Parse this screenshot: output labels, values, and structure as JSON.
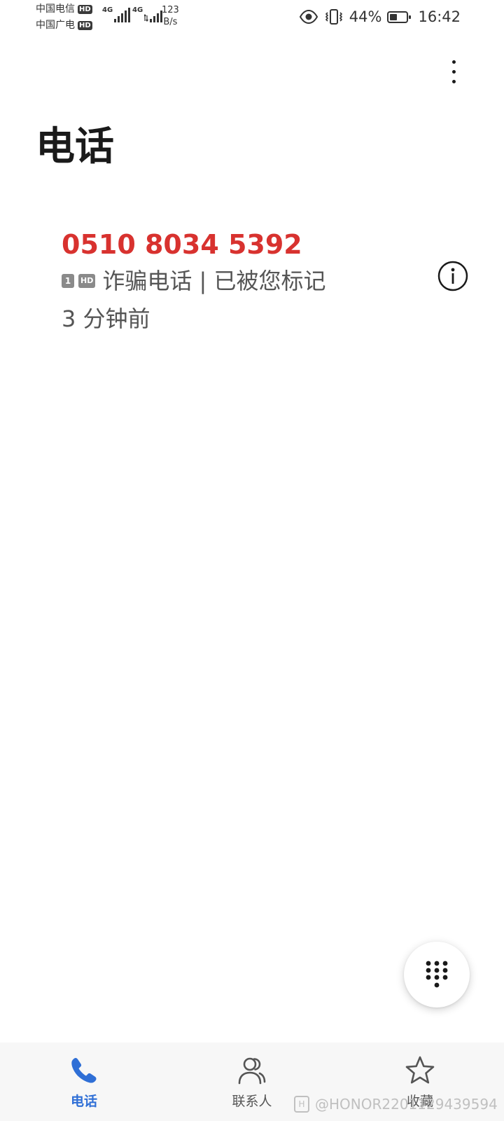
{
  "status_bar": {
    "carrier1": "中国电信",
    "carrier2": "中国广电",
    "hd": "HD",
    "net_type": "4G",
    "speed_value": "123",
    "speed_unit": "B/s",
    "battery_percent": "44%",
    "battery_level": 0.44,
    "time": "16:42",
    "icons": [
      "eye-comfort-icon",
      "vibrate-icon",
      "battery-icon"
    ]
  },
  "header": {
    "title": "电话",
    "menu_icon": "more-vertical-icon"
  },
  "call_log": [
    {
      "number": "0510 8034 5392",
      "sim": "1",
      "hd": "HD",
      "label": "诈骗电话 | 已被您标记",
      "time": "3 分钟前",
      "color": "#d8322f",
      "info_icon": "info-icon"
    }
  ],
  "fab": {
    "icon": "dialpad-icon"
  },
  "bottom_nav": {
    "items": [
      {
        "label": "电话",
        "icon": "phone-icon",
        "active": true
      },
      {
        "label": "联系人",
        "icon": "contacts-icon",
        "active": false
      },
      {
        "label": "收藏",
        "icon": "star-icon",
        "active": false
      }
    ],
    "active_color": "#2f6fd6"
  },
  "watermark": {
    "text": "@HONOR2201129439594",
    "badge": "H"
  }
}
